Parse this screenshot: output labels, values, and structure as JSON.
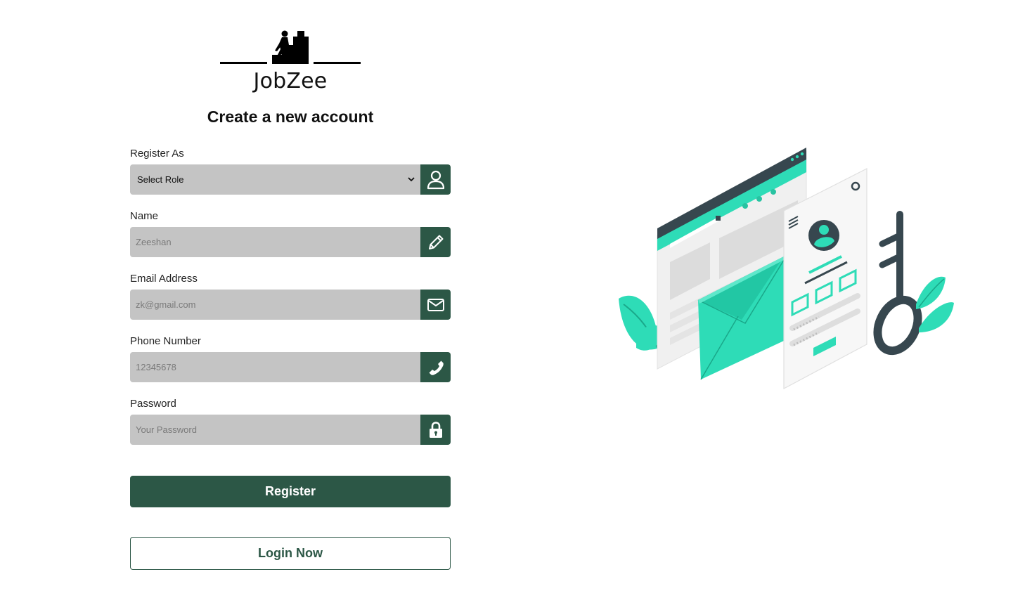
{
  "brand": {
    "name": "JobZee"
  },
  "form": {
    "title": "Create a new account",
    "role": {
      "label": "Register As",
      "selected": "Select Role"
    },
    "name": {
      "label": "Name",
      "placeholder": "Zeeshan"
    },
    "email": {
      "label": "Email Address",
      "placeholder": "zk@gmail.com"
    },
    "phone": {
      "label": "Phone Number",
      "placeholder": "12345678"
    },
    "password": {
      "label": "Password",
      "placeholder": "Your Password"
    },
    "register_label": "Register",
    "login_label": "Login Now"
  },
  "icons": {
    "role": "user-icon",
    "name": "pencil-icon",
    "email": "envelope-icon",
    "phone": "phone-icon",
    "password": "lock-icon"
  },
  "colors": {
    "accent": "#2c5746",
    "input_bg": "#c4c4c4",
    "illustration_teal": "#2edcb7"
  }
}
